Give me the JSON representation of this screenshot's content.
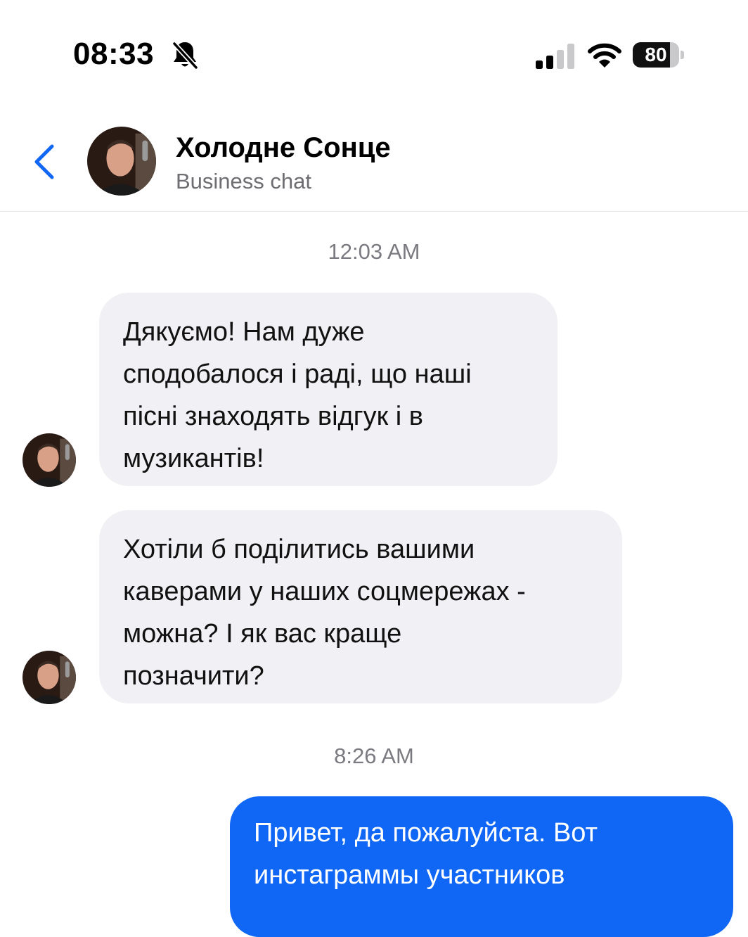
{
  "status_bar": {
    "time": "08:33",
    "battery_level": "80",
    "battery_fraction": 0.8,
    "icons": [
      "bell-slash-icon",
      "cellular-signal-icon",
      "wifi-icon",
      "battery-icon"
    ]
  },
  "header": {
    "back_icon": "chevron-left-icon",
    "contact_name": "Холодне Сонце",
    "subtitle": "Business chat"
  },
  "messages": [
    {
      "type": "timestamp",
      "text": "12:03 AM"
    },
    {
      "type": "incoming",
      "lines": [
        "Дякуємо! Нам дуже",
        "сподобалося і раді, що наші",
        "пісні знаходять відгук і в",
        "музикантів!"
      ]
    },
    {
      "type": "incoming",
      "lines": [
        "Хотіли б поділитись вашими",
        "каверами у наших соцмережах -",
        "можна? І як вас краще",
        "позначити?"
      ]
    },
    {
      "type": "timestamp",
      "text": "8:26 AM"
    },
    {
      "type": "outgoing",
      "lines": [
        "Привет, да пожалуйста. Вот",
        "инстаграммы участников"
      ]
    }
  ],
  "colors": {
    "accent": "#1066f5",
    "incoming_bubble": "#f1f1f5",
    "outgoing_text": "#ffffff",
    "secondary_text": "#6d6d72"
  }
}
